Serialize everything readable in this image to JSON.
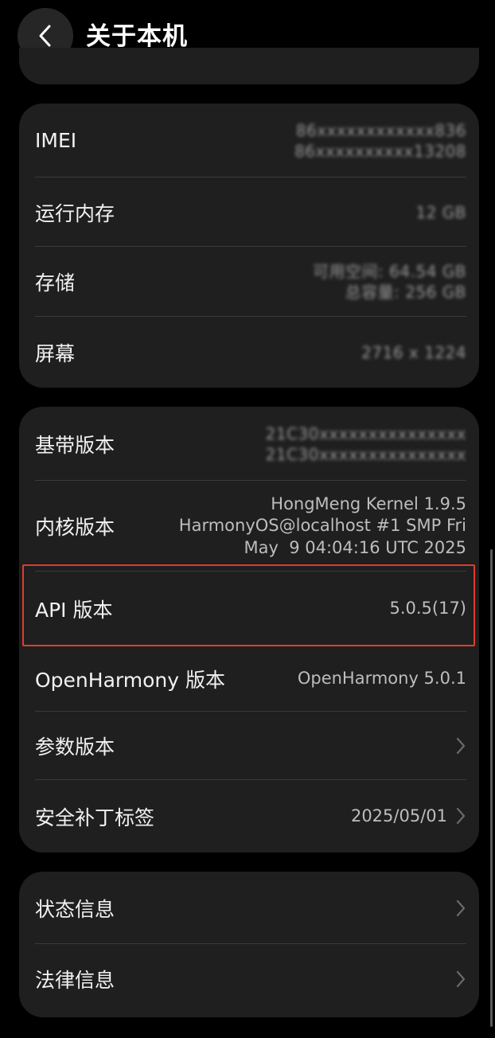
{
  "header": {
    "title": "关于本机",
    "back_icon": "chevron-left-icon"
  },
  "device_card": {
    "rows": [
      {
        "label": "IMEI",
        "value_line1": "86xxxxxxxxxxxx836",
        "value_line2": "86xxxxxxxxxx13208"
      },
      {
        "label": "运行内存",
        "value_line1": "12 GB"
      },
      {
        "label": "存储",
        "value_line1": "可用空间: 64.54 GB",
        "value_line2": "总容量: 256 GB"
      },
      {
        "label": "屏幕",
        "value_line1": "2716 x 1224"
      }
    ]
  },
  "version_card": {
    "rows": [
      {
        "label": "基带版本",
        "value_line1": "21C30xxxxxxxxxxxxxxx",
        "value_line2": "21C30xxxxxxxxxxxxxxx"
      },
      {
        "label": "内核版本",
        "value_line1": "HongMeng Kernel 1.9.5",
        "value_line2": "HarmonyOS@localhost #1 SMP Fri",
        "value_line3": "May  9 04:04:16 UTC 2025"
      },
      {
        "label": "API 版本",
        "value_line1": "5.0.5(17)"
      },
      {
        "label": "OpenHarmony 版本",
        "value_line1": "OpenHarmony 5.0.1"
      },
      {
        "label": "参数版本",
        "value_line1": ""
      },
      {
        "label": "安全补丁标签",
        "value_line1": "2025/05/01"
      }
    ]
  },
  "info_card": {
    "rows": [
      {
        "label": "状态信息"
      },
      {
        "label": "法律信息"
      }
    ]
  },
  "colors": {
    "background": "#000000",
    "card": "#1f1f1f",
    "highlight": "#e23b2b"
  }
}
